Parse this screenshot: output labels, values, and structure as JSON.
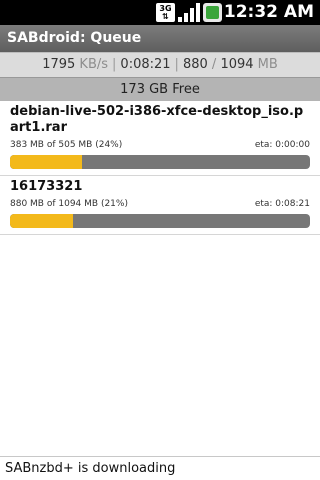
{
  "status_bar": {
    "network": "3G",
    "time": "12:32 AM",
    "icons": [
      "3g-icon",
      "signal-icon",
      "battery-icon"
    ]
  },
  "app": {
    "title": "SABdroid: Queue"
  },
  "stats": {
    "speed_value": "1795",
    "speed_unit": "KB/s",
    "separator": "|",
    "time_left": "0:08:21",
    "done_mb": "880",
    "slash": "/",
    "total_mb": "1094",
    "size_unit": "MB"
  },
  "free_space": "173 GB Free",
  "queue": [
    {
      "name": "debian-live-502-i386-xfce-desktop_iso.part1.rar",
      "progress_text": "383 MB of 505 MB (24%)",
      "eta": "eta: 0:00:00",
      "percent": 24
    },
    {
      "name": "16173321",
      "progress_text": "880 MB of 1094 MB (21%)",
      "eta": "eta: 0:08:21",
      "percent": 21
    }
  ],
  "footer": {
    "status": "SABnzbd+ is downloading"
  },
  "colors": {
    "progress_fill": "#f3b91b",
    "progress_track": "#777777",
    "title_bar": "#6b6b6b"
  }
}
